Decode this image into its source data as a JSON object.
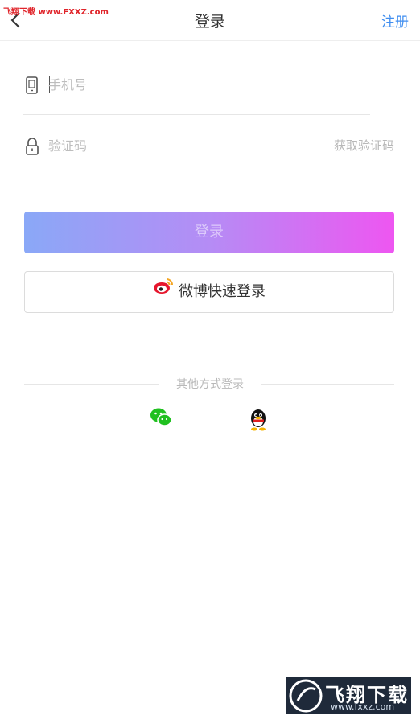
{
  "watermark_top": "飞翔下载 www.FXXZ.com",
  "header": {
    "title": "登录",
    "register_label": "注册"
  },
  "form": {
    "phone_placeholder": "手机号",
    "code_placeholder": "验证码",
    "get_code_label": "获取验证码"
  },
  "buttons": {
    "login_label": "登录",
    "weibo_label": "微博快速登录"
  },
  "other": {
    "label": "其他方式登录",
    "providers": [
      "wechat-icon",
      "qq-icon"
    ]
  },
  "watermark_bottom": {
    "big": "飞翔下载",
    "small": "www.fxxz.com"
  },
  "colors": {
    "accent": "#3f8ef0",
    "gradient_start": "#8aa8f7",
    "gradient_end": "#ee56f1",
    "wechat": "#20c020"
  }
}
